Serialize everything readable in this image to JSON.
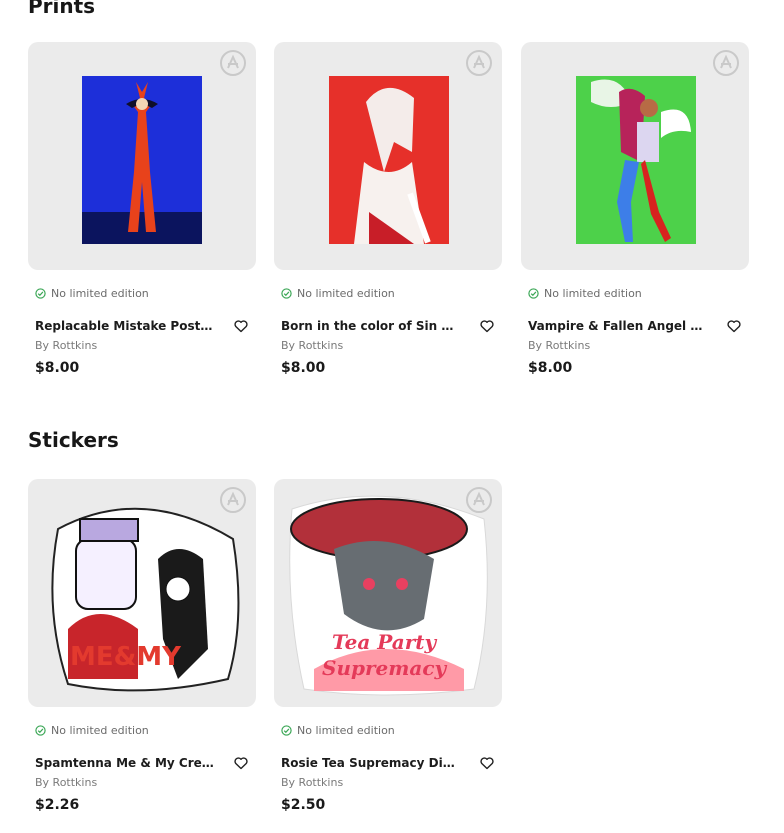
{
  "sections": [
    {
      "title": "Prints",
      "items": [
        {
          "edition": "No limited edition",
          "title": "Replacable Mistake Poster Print",
          "by": "By Rottkins",
          "price": "$8.00"
        },
        {
          "edition": "No limited edition",
          "title": "Born in the color of Sin Poster Print",
          "by": "By Rottkins",
          "price": "$8.00"
        },
        {
          "edition": "No limited edition",
          "title": "Vampire & Fallen Angel Persona Print",
          "by": "By Rottkins",
          "price": "$8.00"
        }
      ]
    },
    {
      "title": "Stickers",
      "items": [
        {
          "edition": "No limited edition",
          "title": "Spamtenna Me & My Creature Sticker",
          "by": "By Rottkins",
          "price": "$2.26"
        },
        {
          "edition": "No limited edition",
          "title": "Rosie Tea Supremacy Die Cut Sticker",
          "by": "By Rottkins",
          "price": "$2.50"
        }
      ]
    }
  ],
  "colors": {
    "card_bg": "#ebebeb",
    "check_green": "#3aa655",
    "text_dark": "#1c1c1c",
    "text_muted": "#7a7a7a"
  },
  "icons": {
    "edition": "check-circle-icon",
    "wishlist": "heart-icon",
    "badge": "ar-badge-icon"
  }
}
